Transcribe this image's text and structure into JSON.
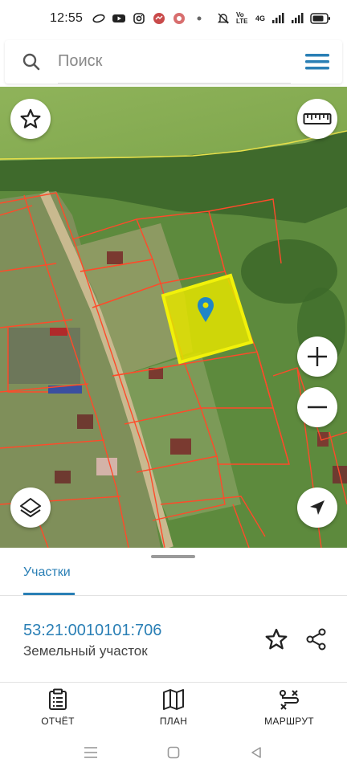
{
  "status_bar": {
    "time": "12:55",
    "network_label": "Vo LTE",
    "signal_label": "4G"
  },
  "search": {
    "placeholder": "Поиск"
  },
  "map": {
    "selected_parcel_color": "#e3e300",
    "parcel_border_color": "#ff4a2a",
    "marker_color": "#1f86c6"
  },
  "sheet": {
    "tab_label": "Участки",
    "cadastral_number": "53:21:0010101:706",
    "parcel_type": "Земельный участок"
  },
  "bottom_nav": {
    "items": [
      {
        "label": "ОТЧЁТ",
        "icon": "report-icon"
      },
      {
        "label": "ПЛАН",
        "icon": "map-plan-icon"
      },
      {
        "label": "МАРШРУТ",
        "icon": "route-icon"
      }
    ]
  },
  "colors": {
    "accent": "#2a7fb5"
  }
}
